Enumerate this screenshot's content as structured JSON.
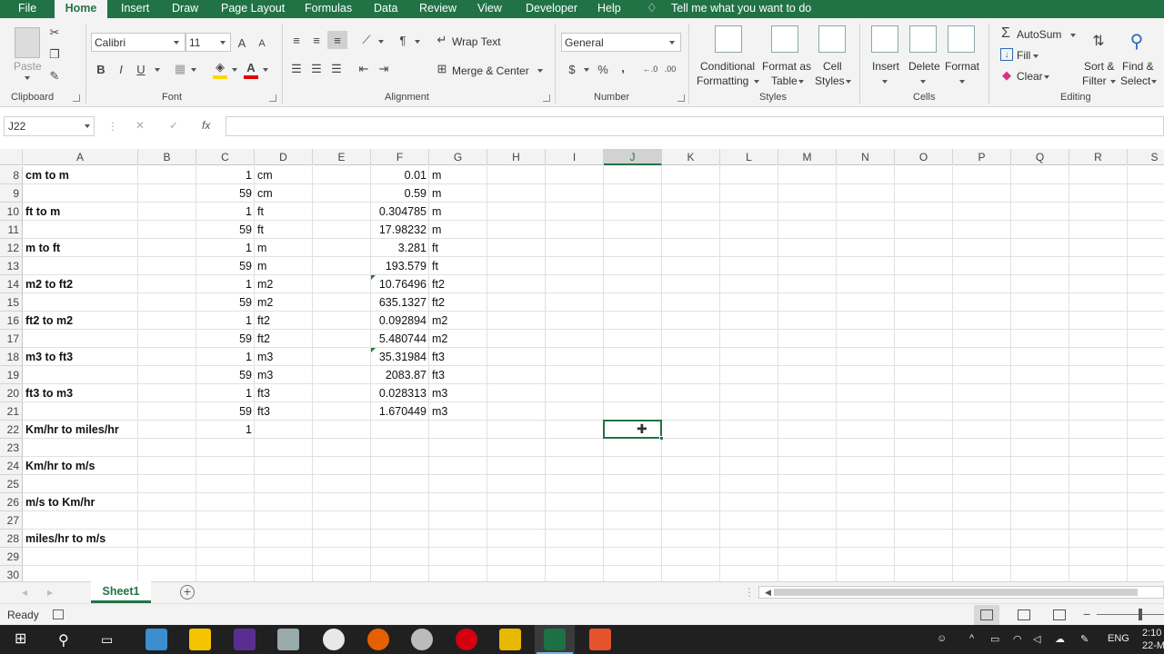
{
  "tabs": [
    "File",
    "Home",
    "Insert",
    "Draw",
    "Page Layout",
    "Formulas",
    "Data",
    "Review",
    "View",
    "Developer",
    "Help"
  ],
  "tell_me": "Tell me what you want to do",
  "ribbon": {
    "clipboard": {
      "paste": "Paste",
      "label": "Clipboard"
    },
    "font": {
      "name": "Calibri",
      "size": "11",
      "bold": "B",
      "italic": "I",
      "underline": "U",
      "label": "Font"
    },
    "alignment": {
      "wrap": "Wrap Text",
      "merge": "Merge & Center",
      "label": "Alignment"
    },
    "number": {
      "format": "General",
      "currency": "$",
      "percent": "%",
      "comma": ",",
      "label": "Number"
    },
    "styles": {
      "cond1": "Conditional",
      "cond2": "Formatting",
      "fmt1": "Format as",
      "fmt2": "Table",
      "cell1": "Cell",
      "cell2": "Styles",
      "label": "Styles"
    },
    "cells": {
      "insert": "Insert",
      "delete": "Delete",
      "format": "Format",
      "label": "Cells"
    },
    "editing": {
      "autosum": "AutoSum",
      "fill": "Fill",
      "clear": "Clear",
      "sort1": "Sort &",
      "sort2": "Filter",
      "find1": "Find &",
      "find2": "Select",
      "label": "Editing"
    },
    "accent": "#217346"
  },
  "formula_bar": {
    "name_box": "J22",
    "fx": "fx",
    "cancel": "✕",
    "enter": "✓",
    "content": ""
  },
  "columns": [
    "A",
    "B",
    "C",
    "D",
    "E",
    "F",
    "G",
    "H",
    "I",
    "J",
    "K",
    "L",
    "M",
    "N",
    "O",
    "P",
    "Q",
    "R",
    "S"
  ],
  "selected_column": "J",
  "rows": [
    {
      "n": "8",
      "a": "cm to m",
      "c": "1",
      "d": "cm",
      "f": "0.01",
      "g": "m"
    },
    {
      "n": "9",
      "a": "",
      "c": "59",
      "d": "cm",
      "f": "0.59",
      "g": "m"
    },
    {
      "n": "10",
      "a": "ft to m",
      "c": "1",
      "d": "ft",
      "f": "0.304785",
      "g": "m"
    },
    {
      "n": "11",
      "a": "",
      "c": "59",
      "d": "ft",
      "f": "17.98232",
      "g": "m"
    },
    {
      "n": "12",
      "a": "m to ft",
      "c": "1",
      "d": "m",
      "f": "3.281",
      "g": "ft"
    },
    {
      "n": "13",
      "a": "",
      "c": "59",
      "d": "m",
      "f": "193.579",
      "g": "ft"
    },
    {
      "n": "14",
      "a": "m2 to ft2",
      "c": "1",
      "d": "m2",
      "f": "10.76496",
      "g": "ft2"
    },
    {
      "n": "15",
      "a": "",
      "c": "59",
      "d": "m2",
      "f": "635.1327",
      "g": "ft2"
    },
    {
      "n": "16",
      "a": "ft2 to m2",
      "c": "1",
      "d": "ft2",
      "f": "0.092894",
      "g": "m2"
    },
    {
      "n": "17",
      "a": "",
      "c": "59",
      "d": "ft2",
      "f": "5.480744",
      "g": "m2"
    },
    {
      "n": "18",
      "a": "m3 to ft3",
      "c": "1",
      "d": "m3",
      "f": "35.31984",
      "g": "ft3"
    },
    {
      "n": "19",
      "a": "",
      "c": "59",
      "d": "m3",
      "f": "2083.87",
      "g": "ft3"
    },
    {
      "n": "20",
      "a": "ft3 to m3",
      "c": "1",
      "d": "ft3",
      "f": "0.028313",
      "g": "m3"
    },
    {
      "n": "21",
      "a": "",
      "c": "59",
      "d": "ft3",
      "f": "1.670449",
      "g": "m3"
    },
    {
      "n": "22",
      "a": "Km/hr to miles/hr",
      "c": "1",
      "d": "",
      "f": "",
      "g": ""
    },
    {
      "n": "23",
      "a": "",
      "c": "",
      "d": "",
      "f": "",
      "g": ""
    },
    {
      "n": "24",
      "a": "Km/hr to m/s",
      "c": "",
      "d": "",
      "f": "",
      "g": ""
    },
    {
      "n": "25",
      "a": "",
      "c": "",
      "d": "",
      "f": "",
      "g": ""
    },
    {
      "n": "26",
      "a": "m/s to Km/hr",
      "c": "",
      "d": "",
      "f": "",
      "g": ""
    },
    {
      "n": "27",
      "a": "",
      "c": "",
      "d": "",
      "f": "",
      "g": ""
    },
    {
      "n": "28",
      "a": "miles/hr to m/s",
      "c": "",
      "d": "",
      "f": "",
      "g": ""
    },
    {
      "n": "29",
      "a": "",
      "c": "",
      "d": "",
      "f": "",
      "g": ""
    },
    {
      "n": "30",
      "a": "",
      "c": "",
      "d": "",
      "f": "",
      "g": ""
    }
  ],
  "sheet": {
    "name": "Sheet1",
    "add": "+"
  },
  "status": {
    "ready": "Ready"
  },
  "taskbar": {
    "lang": "ENG",
    "time": "2:10",
    "date": "22-M"
  }
}
